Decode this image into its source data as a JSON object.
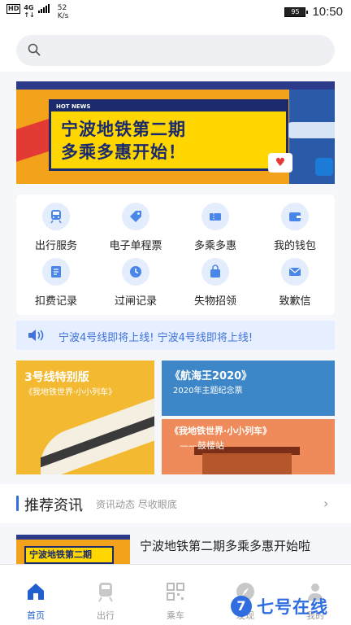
{
  "status_bar": {
    "hd": "HD",
    "network_top": "4G",
    "network_bottom": "↑↓",
    "speed_value": "52",
    "speed_unit": "K/s",
    "battery": "95",
    "time": "10:50"
  },
  "search": {
    "placeholder": ""
  },
  "banner": {
    "hot_label": "HOT NEWS",
    "title_line1": "宁波地铁第二期",
    "title_line2": "多乘多惠开始！"
  },
  "services": [
    {
      "label": "出行服务",
      "icon": "train-icon"
    },
    {
      "label": "电子单程票",
      "icon": "ticket-tag-icon"
    },
    {
      "label": "多乘多惠",
      "icon": "coupon-icon"
    },
    {
      "label": "我的钱包",
      "icon": "wallet-icon"
    },
    {
      "label": "扣费记录",
      "icon": "record-icon"
    },
    {
      "label": "过闸记录",
      "icon": "clock-icon"
    },
    {
      "label": "失物招领",
      "icon": "lost-found-icon"
    },
    {
      "label": "致歉信",
      "icon": "mail-icon"
    }
  ],
  "notice": {
    "text": "宁波4号线即将上线! 宁波4号线即将上线!"
  },
  "promos": {
    "left": {
      "title": "3号线特别版",
      "subtitle": "《我地铁世界·小小列车》"
    },
    "right_top": {
      "title": "《航海王2020》",
      "subtitle": "2020年主题纪念票"
    },
    "right_bottom": {
      "title": "《我地铁世界·小小列车》",
      "subtitle": "——鼓楼站"
    }
  },
  "news_section": {
    "title": "推荐资讯",
    "subtitle": "资讯动态 尽收眼底",
    "items": [
      {
        "title": "宁波地铁第二期多乘多惠开始啦",
        "thumb_text": "宁波地铁第二期"
      }
    ]
  },
  "tabbar": {
    "tabs": [
      {
        "label": "首页",
        "active": true
      },
      {
        "label": "出行",
        "active": false
      },
      {
        "label": "乘车",
        "active": false
      },
      {
        "label": "发现",
        "active": false
      },
      {
        "label": "我的",
        "active": false
      }
    ]
  },
  "watermark": {
    "text": "七号在线",
    "mark": "7"
  },
  "colors": {
    "accent": "#2f6de0",
    "notice_bg": "#e6efff",
    "icon_bg": "#e3edfb"
  }
}
